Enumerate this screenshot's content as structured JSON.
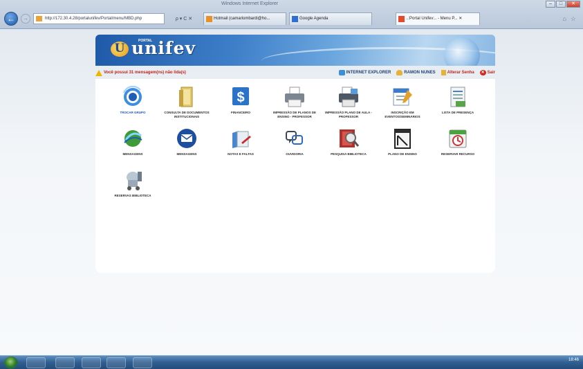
{
  "browser": {
    "window_title": "Windows Internet Explorer",
    "address": "http://172.30.4.28/portalunifev/Portal/menu/MBD.php",
    "addr_tools": "ρ ▾ C ✕",
    "tabs": [
      {
        "label": "Hotmail (camarlombardi@ho...",
        "color": "#e8912a"
      },
      {
        "label": "Google Agenda",
        "color": "#2f6fd1"
      },
      {
        "label": "..:Portal Unifev:.. - Menu P... ✕",
        "color": "#e64a2e"
      }
    ],
    "nav_icons": [
      "home-icon",
      "star-icon"
    ]
  },
  "portal": {
    "logo_sup": "PORTAL",
    "logo_text": "unifev",
    "logo_mark": "U",
    "alert": "Você possui 31 mensagem(ns) não lida(s)",
    "links": [
      {
        "label": "INTERNET EXPLORER",
        "icon": "ie-icon"
      },
      {
        "label": "RAMON NUNES",
        "icon": "user-icon"
      },
      {
        "label": "Alterar Senha",
        "icon": "key-icon"
      },
      {
        "label": "Sair",
        "icon": "exit-icon"
      }
    ]
  },
  "menu": [
    {
      "label": "TROCAR GRUPO",
      "icon": "switch-group-icon",
      "highlight": true
    },
    {
      "label": "CONSULTA DE DOCUMENTOS INSTITUCIONAIS",
      "icon": "documents-icon"
    },
    {
      "label": "FINANCEIRO",
      "icon": "dollar-icon"
    },
    {
      "label": "IMPRESSÃO DE PLANOS DE ENSINO - PROFESSOR",
      "icon": "printer-icon"
    },
    {
      "label": "IMPRESSÃO PLANO DE AULA - PROFESSOR",
      "icon": "printer-plan-icon"
    },
    {
      "label": "INSCRIÇÃO EM EVENTOS/SEMINÁRIOS",
      "icon": "event-signup-icon"
    },
    {
      "label": "LISTA DE PRESENÇA",
      "icon": "attendance-list-icon"
    },
    {
      "label": "MENSAGENS",
      "icon": "globe-messages-icon"
    },
    {
      "label": "MENSAGENS",
      "icon": "envelope-icon"
    },
    {
      "label": "NOTAS E FALTAS",
      "icon": "grades-icon"
    },
    {
      "label": "OUVIDORIA",
      "icon": "ombudsman-icon"
    },
    {
      "label": "PESQUISA BIBLIOTECA",
      "icon": "library-search-icon"
    },
    {
      "label": "PLANO DE ENSINO",
      "icon": "teaching-plan-icon"
    },
    {
      "label": "RESERVAR RECURSO",
      "icon": "reserve-resource-icon"
    },
    {
      "label": "RESERVAS BIBLIOTECA",
      "icon": "library-reservations-icon"
    }
  ],
  "taskbar": {
    "clock_time": "18:46",
    "apps": [
      "ie-icon",
      "folder-icon",
      "media-icon",
      "explorer-icon",
      "window-icon"
    ]
  },
  "colors": {
    "alert": "#c0241b",
    "banner": "#2a66b3",
    "accent_blue": "#1b57b3"
  }
}
